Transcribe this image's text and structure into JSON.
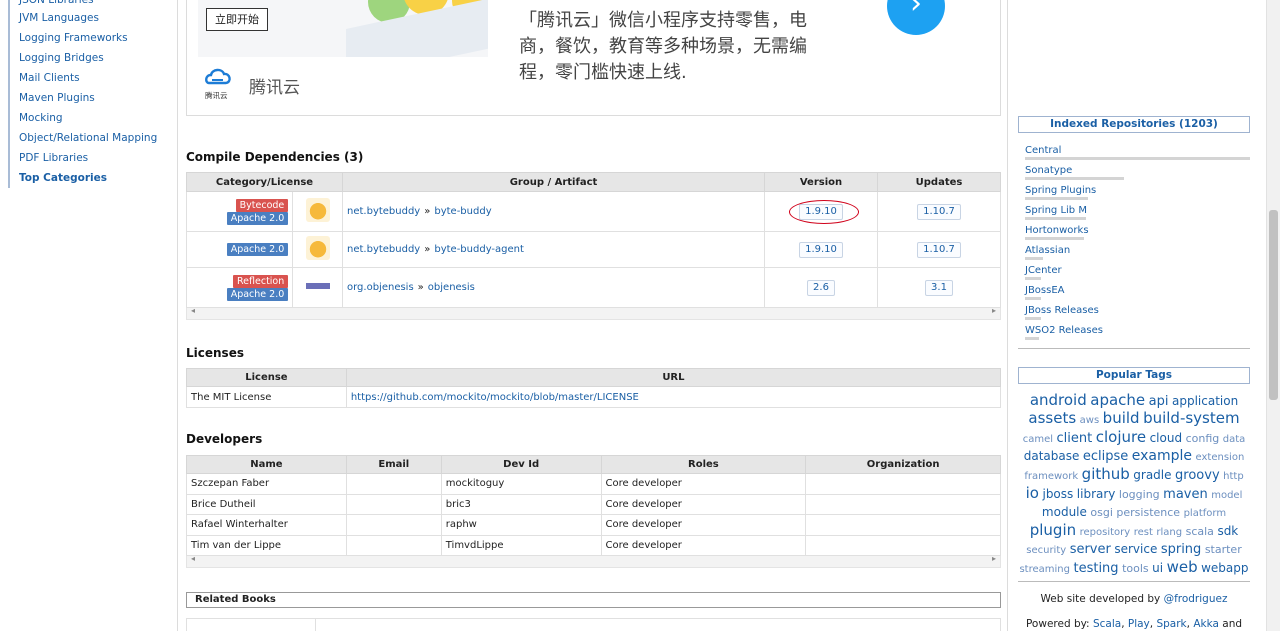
{
  "left_nav": {
    "items": [
      {
        "label": "JSON Libraries",
        "bold": false
      },
      {
        "label": "JVM Languages",
        "bold": false
      },
      {
        "label": "Logging Frameworks",
        "bold": false
      },
      {
        "label": "Logging Bridges",
        "bold": false
      },
      {
        "label": "Mail Clients",
        "bold": false
      },
      {
        "label": "Maven Plugins",
        "bold": false
      },
      {
        "label": "Mocking",
        "bold": false
      },
      {
        "label": "Object/Relational Mapping",
        "bold": false
      },
      {
        "label": "PDF Libraries",
        "bold": false
      },
      {
        "label": "Top Categories",
        "bold": true
      }
    ]
  },
  "ad": {
    "button": "立即开始",
    "brand": "腾讯云",
    "logo_caption": "腾讯云",
    "text": "「腾讯云」微信小程序支持零售，电商，餐饮，教育等多种场景，无需编程，零门槛快速上线.",
    "arrow": "›"
  },
  "dependencies": {
    "title": "Compile Dependencies (3)",
    "headers": [
      "Category/License",
      "Group / Artifact",
      "Version",
      "Updates"
    ],
    "rows": [
      {
        "badges": [
          "Bytecode",
          "Apache 2.0"
        ],
        "badge_colors": [
          "red",
          "blue"
        ],
        "group": "net.bytebuddy",
        "artifact": "byte-buddy",
        "version": "1.9.10",
        "update": "1.10.7",
        "highlight": true
      },
      {
        "badges": [
          "Apache 2.0"
        ],
        "badge_colors": [
          "blue"
        ],
        "group": "net.bytebuddy",
        "artifact": "byte-buddy-agent",
        "version": "1.9.10",
        "update": "1.10.7",
        "highlight": false
      },
      {
        "badges": [
          "Reflection",
          "Apache 2.0"
        ],
        "badge_colors": [
          "red",
          "blue"
        ],
        "group": "org.objenesis",
        "artifact": "objenesis",
        "version": "2.6",
        "update": "3.1",
        "highlight": false
      }
    ],
    "separator": "»"
  },
  "licenses": {
    "title": "Licenses",
    "headers": [
      "License",
      "URL"
    ],
    "rows": [
      {
        "license": "The MIT License",
        "url": "https://github.com/mockito/mockito/blob/master/LICENSE"
      }
    ]
  },
  "developers": {
    "title": "Developers",
    "headers": [
      "Name",
      "Email",
      "Dev Id",
      "Roles",
      "Organization"
    ],
    "rows": [
      {
        "name": "Szczepan Faber",
        "email": "",
        "devid": "mockitoguy",
        "roles": "Core developer",
        "org": ""
      },
      {
        "name": "Brice Dutheil",
        "email": "",
        "devid": "bric3",
        "roles": "Core developer",
        "org": ""
      },
      {
        "name": "Rafael Winterhalter",
        "email": "",
        "devid": "raphw",
        "roles": "Core developer",
        "org": ""
      },
      {
        "name": "Tim van der Lippe",
        "email": "",
        "devid": "TimvdLippe",
        "roles": "Core developer",
        "org": ""
      }
    ]
  },
  "related_books": {
    "title": "Related Books"
  },
  "repositories": {
    "title": "Indexed Repositories (1203)",
    "items": [
      {
        "name": "Central",
        "bar": 1.0
      },
      {
        "name": "Sonatype",
        "bar": 0.44
      },
      {
        "name": "Spring Plugins",
        "bar": 0.28
      },
      {
        "name": "Spring Lib M",
        "bar": 0.27
      },
      {
        "name": "Hortonworks",
        "bar": 0.26
      },
      {
        "name": "Atlassian",
        "bar": 0.08
      },
      {
        "name": "JCenter",
        "bar": 0.07
      },
      {
        "name": "JBossEA",
        "bar": 0.07
      },
      {
        "name": "JBoss Releases",
        "bar": 0.07
      },
      {
        "name": "WSO2 Releases",
        "bar": 0.06
      }
    ]
  },
  "popular_tags": {
    "title": "Popular Tags",
    "tags": [
      {
        "t": "android",
        "s": 15
      },
      {
        "t": "apache",
        "s": 15
      },
      {
        "t": "api",
        "s": 13
      },
      {
        "t": "application",
        "s": 12
      },
      {
        "t": "assets",
        "s": 15
      },
      {
        "t": "aws",
        "s": 10
      },
      {
        "t": "build",
        "s": 15
      },
      {
        "t": "build-system",
        "s": 15
      },
      {
        "t": "camel",
        "s": 10
      },
      {
        "t": "client",
        "s": 13
      },
      {
        "t": "clojure",
        "s": 15
      },
      {
        "t": "cloud",
        "s": 12
      },
      {
        "t": "config",
        "s": 11
      },
      {
        "t": "data",
        "s": 10
      },
      {
        "t": "database",
        "s": 12
      },
      {
        "t": "eclipse",
        "s": 13
      },
      {
        "t": "example",
        "s": 14
      },
      {
        "t": "extension",
        "s": 10
      },
      {
        "t": "framework",
        "s": 10
      },
      {
        "t": "github",
        "s": 15
      },
      {
        "t": "gradle",
        "s": 12
      },
      {
        "t": "groovy",
        "s": 13
      },
      {
        "t": "http",
        "s": 10
      },
      {
        "t": "io",
        "s": 15
      },
      {
        "t": "jboss",
        "s": 12
      },
      {
        "t": "library",
        "s": 12
      },
      {
        "t": "logging",
        "s": 11
      },
      {
        "t": "maven",
        "s": 13
      },
      {
        "t": "model",
        "s": 10
      },
      {
        "t": "module",
        "s": 12
      },
      {
        "t": "osgi",
        "s": 11
      },
      {
        "t": "persistence",
        "s": 11
      },
      {
        "t": "platform",
        "s": 10
      },
      {
        "t": "plugin",
        "s": 15
      },
      {
        "t": "repository",
        "s": 10
      },
      {
        "t": "rest",
        "s": 10
      },
      {
        "t": "rlang",
        "s": 10
      },
      {
        "t": "scala",
        "s": 11
      },
      {
        "t": "sdk",
        "s": 12
      },
      {
        "t": "security",
        "s": 10
      },
      {
        "t": "server",
        "s": 13
      },
      {
        "t": "service",
        "s": 12
      },
      {
        "t": "spring",
        "s": 13
      },
      {
        "t": "starter",
        "s": 11
      },
      {
        "t": "streaming",
        "s": 10
      },
      {
        "t": "testing",
        "s": 13
      },
      {
        "t": "tools",
        "s": 11
      },
      {
        "t": "ui",
        "s": 12
      },
      {
        "t": "web",
        "s": 15
      },
      {
        "t": "webapp",
        "s": 12
      }
    ]
  },
  "footer": {
    "dev_prefix": "Web site developed by",
    "dev_handle": "@frodriguez",
    "powered_prefix": "Powered by:",
    "powered": [
      "Scala",
      "Play",
      "Spark",
      "Akka"
    ],
    "powered_suffix": "and"
  },
  "colors": {
    "link": "#1a5fa5",
    "badge_red": "#d9534f",
    "badge_blue": "#4a7fc1",
    "highlight_circle": "#d0021b"
  }
}
